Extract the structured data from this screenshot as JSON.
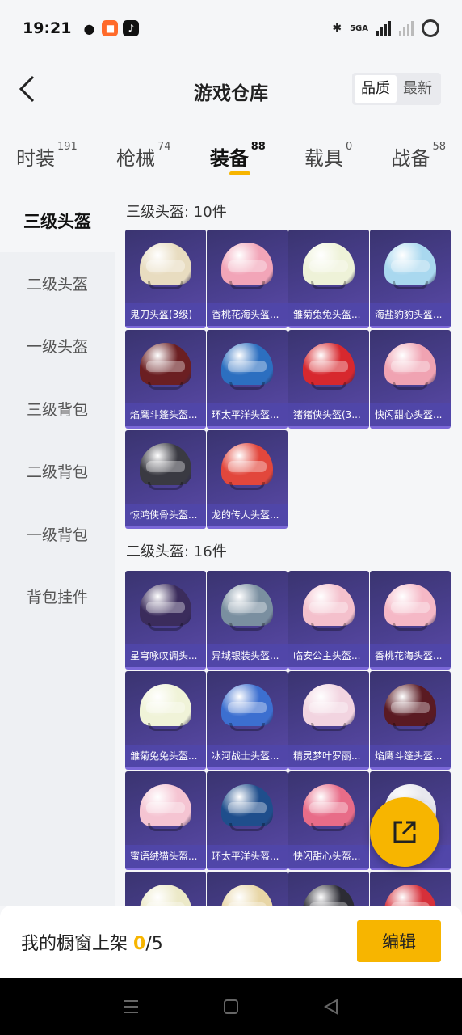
{
  "status": {
    "time": "19:21",
    "network": "5GA"
  },
  "header": {
    "title": "游戏仓库",
    "sort_options": [
      "品质",
      "最新"
    ],
    "active_sort": "品质"
  },
  "tabs": [
    {
      "label": "时装",
      "count": "191"
    },
    {
      "label": "枪械",
      "count": "74"
    },
    {
      "label": "装备",
      "count": "88"
    },
    {
      "label": "载具",
      "count": "0"
    },
    {
      "label": "战备",
      "count": "58"
    }
  ],
  "active_tab": "装备",
  "sidebar": {
    "items": [
      "三级头盔",
      "二级头盔",
      "一级头盔",
      "三级背包",
      "二级背包",
      "一级背包",
      "背包挂件"
    ],
    "active": "三级头盔"
  },
  "sections": [
    {
      "title": "三级头盔: 10件",
      "items": [
        {
          "name": "鬼刀头盔(3级)",
          "color": "#e8dcc0"
        },
        {
          "name": "香桃花海头盔...",
          "color": "#f2a5b8"
        },
        {
          "name": "雏菊兔兔头盔...",
          "color": "#eef2d8"
        },
        {
          "name": "海盐豹豹头盔...",
          "color": "#a9d8ef"
        },
        {
          "name": "焰鹰斗篷头盔...",
          "color": "#6b1f22"
        },
        {
          "name": "环太平洋头盔...",
          "color": "#2c6fc0"
        },
        {
          "name": "猪猪侠头盔(3...",
          "color": "#d7282e"
        },
        {
          "name": "快闪甜心头盔...",
          "color": "#f0a3b2"
        },
        {
          "name": "惊鸿侠骨头盔...",
          "color": "#3a3a42"
        },
        {
          "name": "龙的传人头盔...",
          "color": "#e2473c"
        }
      ]
    },
    {
      "title": "二级头盔: 16件",
      "items": [
        {
          "name": "星穹咏叹调头...",
          "color": "#3b2c5c"
        },
        {
          "name": "异域银装头盔...",
          "color": "#7a8fa0"
        },
        {
          "name": "临安公主头盔...",
          "color": "#f4c0cc"
        },
        {
          "name": "香桃花海头盔...",
          "color": "#f5b8c6"
        },
        {
          "name": "雏菊兔兔头盔...",
          "color": "#f0f3d8"
        },
        {
          "name": "冰河战士头盔...",
          "color": "#3c6fd0"
        },
        {
          "name": "精灵梦叶罗丽...",
          "color": "#f2d4e0"
        },
        {
          "name": "焰鹰斗篷头盔...",
          "color": "#5a1a22"
        },
        {
          "name": "蜜语绒猫头盔...",
          "color": "#f5c4d2"
        },
        {
          "name": "环太平洋头盔...",
          "color": "#1f4e8c"
        },
        {
          "name": "快闪甜心头盔...",
          "color": "#e86c88"
        },
        {
          "name": "",
          "color": "#e8e8ee"
        },
        {
          "name": "",
          "color": "#ece9c8"
        },
        {
          "name": "",
          "color": "#e8d6a6"
        },
        {
          "name": "",
          "color": "#2c2c34"
        },
        {
          "name": "",
          "color": "#d6303a"
        }
      ]
    }
  ],
  "bottom": {
    "showcase_label": "我的橱窗上架",
    "showcase_count": "0",
    "showcase_total": "/5",
    "edit_label": "编辑"
  },
  "colors": {
    "accent": "#f7b500",
    "card_bg": "#4a3f8f"
  }
}
